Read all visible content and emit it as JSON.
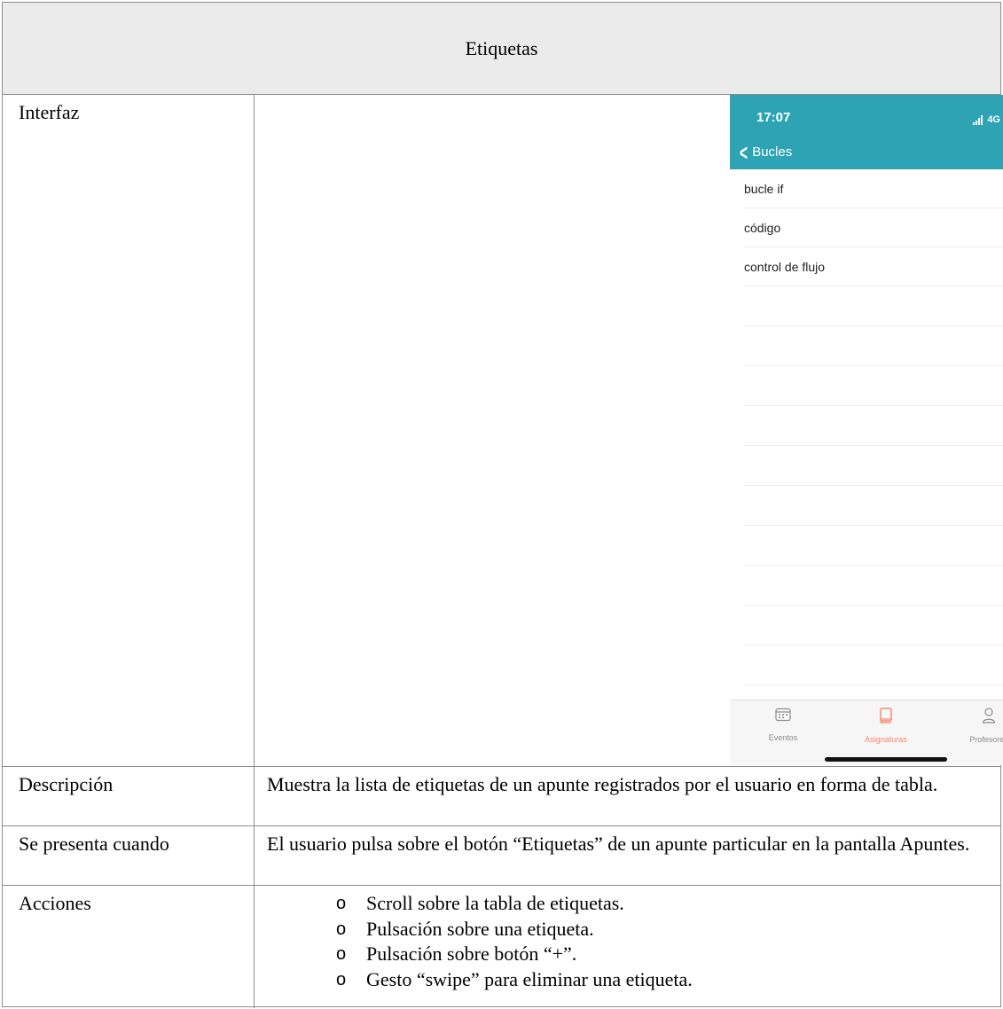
{
  "document": {
    "title": "Etiquetas",
    "rows": {
      "interfaz": {
        "label": "Interfaz"
      },
      "descripcion": {
        "label": "Descripción",
        "value": "Muestra la lista de etiquetas de un apunte registrados por el usuario en forma de tabla."
      },
      "presenta": {
        "label": "Se presenta cuando",
        "value": "El usuario pulsa sobre el botón “Etiquetas” de un apunte particular en la pantalla Apuntes."
      },
      "acciones": {
        "label": "Acciones",
        "items": [
          "Scroll sobre la tabla de etiquetas.",
          "Pulsación sobre una etiqueta.",
          "Pulsación sobre botón “+”.",
          "Gesto “swipe” para eliminar una etiqueta."
        ],
        "bullet": "o"
      }
    }
  },
  "phone": {
    "status_bar": {
      "time": "17:07",
      "network": "4G"
    },
    "nav": {
      "back_label": "Bucles",
      "add_label": "+"
    },
    "tags": [
      "bucle if",
      "código",
      "control de flujo"
    ],
    "tab_bar": {
      "eventos": "Eventos",
      "asignaturas": "Asignaturas",
      "profesores": "Profesores"
    },
    "colors": {
      "accent": "#2da3b3",
      "active_tab": "#f4886a"
    }
  }
}
